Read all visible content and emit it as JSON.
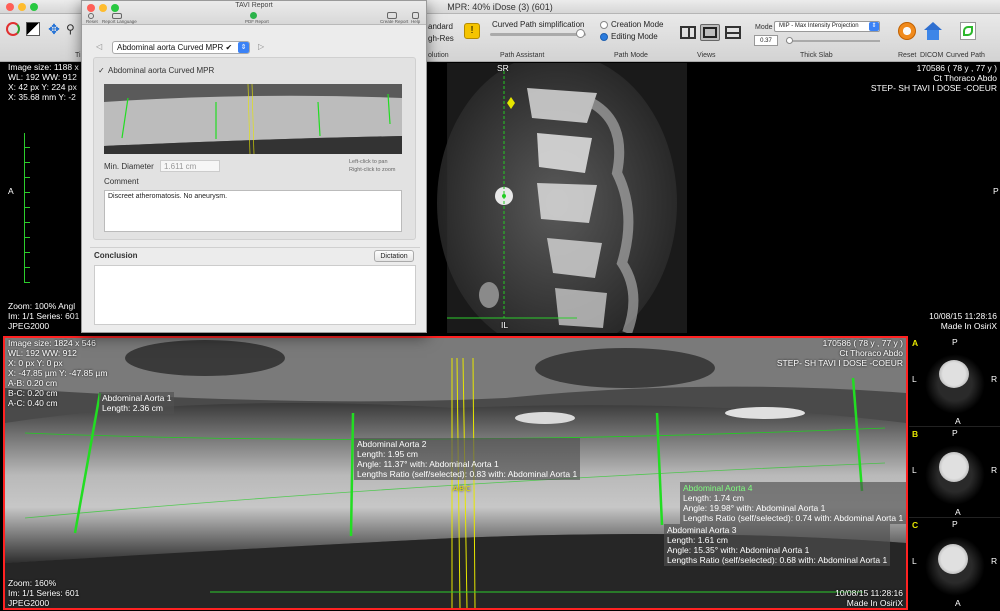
{
  "window_title": "MPR: 40% iDose (3) (601)",
  "toolbar": {
    "standard": "andard",
    "high_res": "gh-Res",
    "resolution_label": "olution",
    "path_simplification": "Curved Path simplification",
    "path_assistant_label": "Path Assistant",
    "creation_mode": "Creation Mode",
    "editing_mode": "Editing Mode",
    "path_mode_label": "Path Mode",
    "views_label": "Views",
    "mode_label": "Mode",
    "mode_value": "MIP - Max Intensity Projection",
    "slab_value": "0.37",
    "thick_slab_label": "Thick Slab",
    "reset_label": "Reset",
    "dicom_label": "DICOM",
    "curved_path_label": "Curved Path",
    "left_tool_label": "Ti"
  },
  "top_left_viewport": {
    "image_size": "Image size: 1188 x",
    "wl": "WL: 192 WW: 912",
    "xy_px": "X: 42 px Y: 224 px",
    "xy_mm": "X: 35.68 mm Y: -2",
    "orient_left": "A",
    "zoom": "Zoom: 100% Angl",
    "im_series": "Im: 1/1  Series: 601",
    "codec": "JPEG2000"
  },
  "top_right_viewport": {
    "orient_top": "SR",
    "orient_bottom": "IL",
    "orient_right": "P",
    "patient_id": "170586 ( 78 y , 77 y )",
    "study": "Ct Thoraco Abdo",
    "series_desc": "STEP- SH TAVI I DOSE -COEUR",
    "datetime": "10/08/15 11:28:16",
    "made_in": "Made In OsiriX"
  },
  "bottom_viewport": {
    "image_size": "Image size: 1824 x 546",
    "wl": "WL: 192 WW: 912",
    "xy_px": "X: 0 px Y: 0 px",
    "xy_um": "X: -47.85 µm Y: -47.85 µm",
    "ab": "A-B: 0.20 cm",
    "bc": "B-C: 0.20 cm",
    "ac": "A-C: 0.40 cm",
    "zoom": "Zoom: 160%",
    "im_series": "Im: 1/1  Series: 601",
    "codec": "JPEG2000",
    "patient_id": "170586 ( 78 y , 77 y )",
    "study": "Ct Thoraco Abdo",
    "series_desc": "STEP- SH TAVI I DOSE -COEUR",
    "datetime": "10/08/15 11:28:16",
    "made_in": "Made In OsiriX",
    "abc_label": "A B C",
    "measurements": [
      {
        "name": "Abdominal Aorta 1",
        "length": "Length: 2.36 cm"
      },
      {
        "name": "Abdominal Aorta 2",
        "length": "Length: 1.95 cm",
        "angle": "Angle: 11.37° with: Abdominal Aorta 1",
        "ratio": "Lengths Ratio (self/selected): 0.83 with: Abdominal Aorta 1"
      },
      {
        "name": "Abdominal Aorta 4",
        "length": "Length: 1.74 cm",
        "angle": "Angle: 19.98° with: Abdominal Aorta 1",
        "ratio": "Lengths Ratio (self/selected): 0.74 with: Abdominal Aorta 1"
      },
      {
        "name": "Abdominal Aorta 3",
        "length": "Length: 1.61 cm",
        "angle": "Angle: 15.35° with: Abdominal Aorta 1",
        "ratio": "Lengths Ratio (self/selected): 0.68 with: Abdominal Aorta 1"
      }
    ]
  },
  "thumbnails": [
    {
      "letter": "A",
      "top": "P",
      "left": "L",
      "right": "R",
      "bottom": "A"
    },
    {
      "letter": "B",
      "top": "P",
      "left": "L",
      "right": "R",
      "bottom": "A"
    },
    {
      "letter": "C",
      "top": "P",
      "left": "L",
      "right": "R",
      "bottom": "A"
    }
  ],
  "report": {
    "title": "TAVI Report",
    "reset_label": "Reset",
    "language_label": "Report Language",
    "pdf_label": "PDF Report",
    "create_label": "Create Report",
    "help_label": "Help",
    "section_select": "Abdominal aorta Curved MPR ✔",
    "section_check": "Abdominal aorta Curved MPR",
    "min_diameter_label": "Min. Diameter",
    "min_diameter_value": "1.611 cm",
    "hint_pan": "Left-click to pan",
    "hint_zoom": "Right-click to zoom",
    "comment_label": "Comment",
    "comment_text": "Discreet atheromatosis. No aneurysm.",
    "conclusion_label": "Conclusion",
    "dictation_button": "Dictation"
  },
  "colors": {
    "measurement_line": "#22dd22",
    "crosshair": "#e6e600",
    "selection_border": "#ff2222"
  }
}
